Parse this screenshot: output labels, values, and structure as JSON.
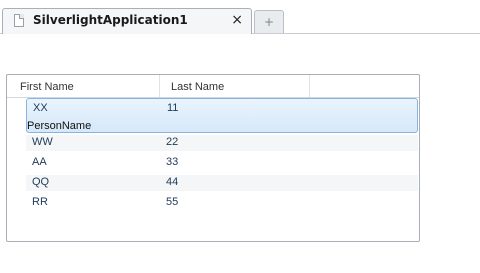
{
  "browser": {
    "tab_title": "SilverlightApplication1",
    "close_glyph": "×",
    "new_tab_glyph": "+"
  },
  "grid": {
    "columns": [
      "First Name",
      "Last Name"
    ],
    "selected_row": {
      "first": "XX",
      "last": "11",
      "details": "PersonName"
    },
    "rows": [
      {
        "first": "WW",
        "last": "22"
      },
      {
        "first": "AA",
        "last": "33"
      },
      {
        "first": "QQ",
        "last": "44"
      },
      {
        "first": "RR",
        "last": "55"
      }
    ]
  },
  "colors": {
    "selection_border": "#8ab4e0",
    "selection_fill": "#d6e8f9",
    "cell_text": "#1f3a5a"
  }
}
